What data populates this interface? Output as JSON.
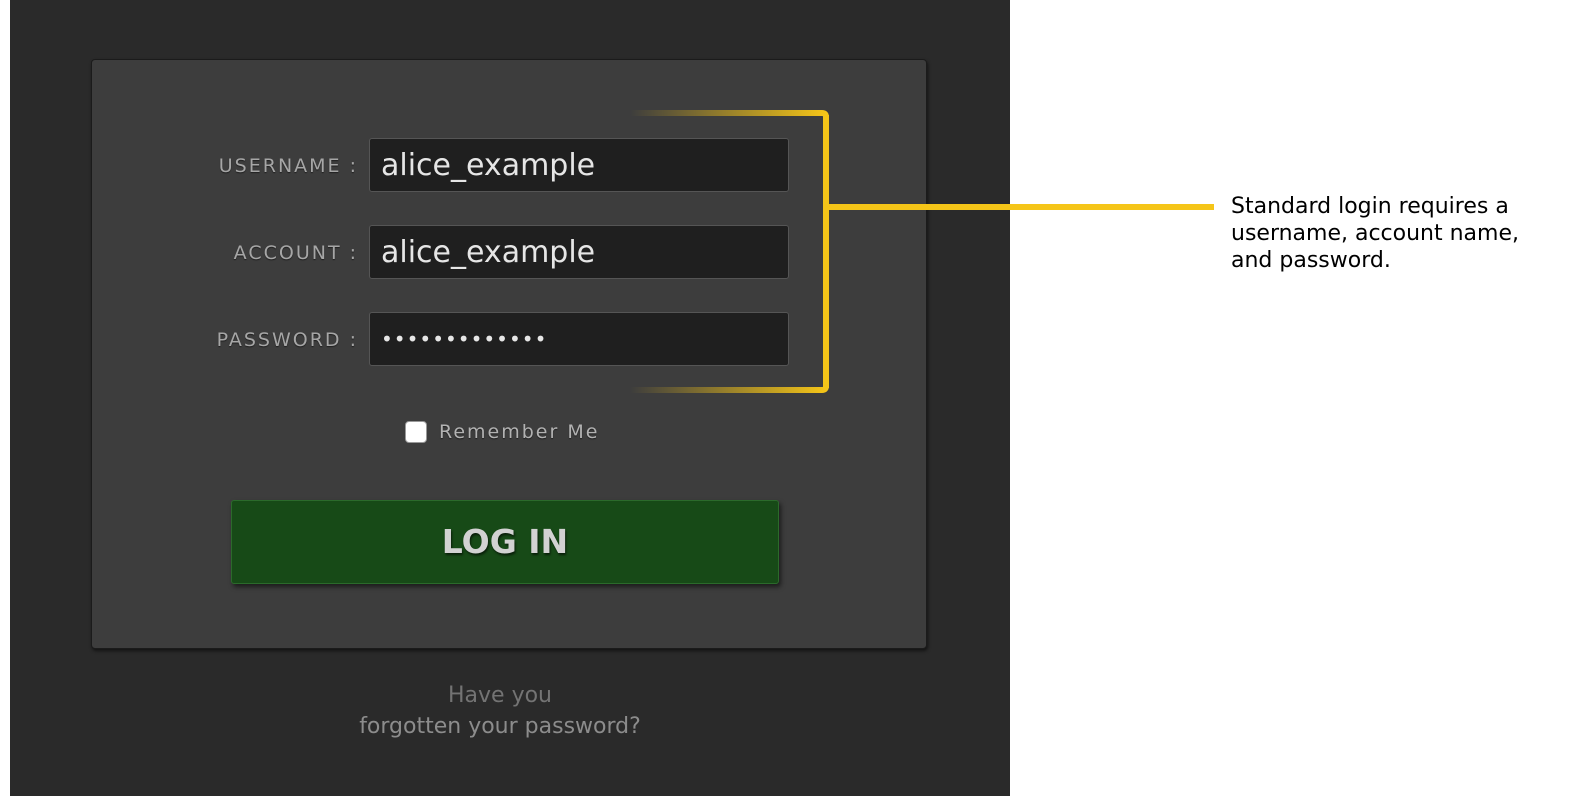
{
  "form": {
    "username_label": "USERNAME :",
    "username_value": "alice_example",
    "account_label": "ACCOUNT :",
    "account_value": "alice_example",
    "password_label": "PASSWORD :",
    "password_value": "•••••••••••••",
    "remember_label": "Remember Me",
    "remember_checked": false,
    "login_label": "LOG IN",
    "forgot_line1": "Have you",
    "forgot_line2": "forgotten your password?"
  },
  "annotation": {
    "text_lines": [
      "Standard login requires a",
      "username, account name,",
      "and password."
    ],
    "color": "#f5c518"
  },
  "colors": {
    "background": "#2a2a2a",
    "card": "#3d3d3d",
    "input": "#1f1f1f",
    "button": "#174a17"
  }
}
